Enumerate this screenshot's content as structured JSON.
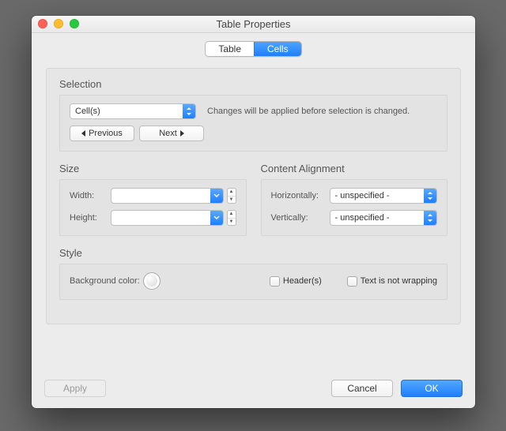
{
  "window": {
    "title": "Table Properties"
  },
  "tabs": {
    "table": "Table",
    "cells": "Cells",
    "selected": "cells"
  },
  "selection": {
    "heading": "Selection",
    "scope": "Cell(s)",
    "prev_label": "Previous",
    "next_label": "Next",
    "hint": "Changes will be applied before selection is changed."
  },
  "size": {
    "heading": "Size",
    "width_label": "Width:",
    "width_value": "",
    "height_label": "Height:",
    "height_value": ""
  },
  "alignment": {
    "heading": "Content Alignment",
    "horiz_label": "Horizontally:",
    "horiz_value": "- unspecified -",
    "vert_label": "Vertically:",
    "vert_value": "- unspecified -"
  },
  "style": {
    "heading": "Style",
    "bg_label": "Background color:",
    "header_label": "Header(s)",
    "nowrap_label": "Text is not wrapping"
  },
  "footer": {
    "apply": "Apply",
    "cancel": "Cancel",
    "ok": "OK"
  }
}
